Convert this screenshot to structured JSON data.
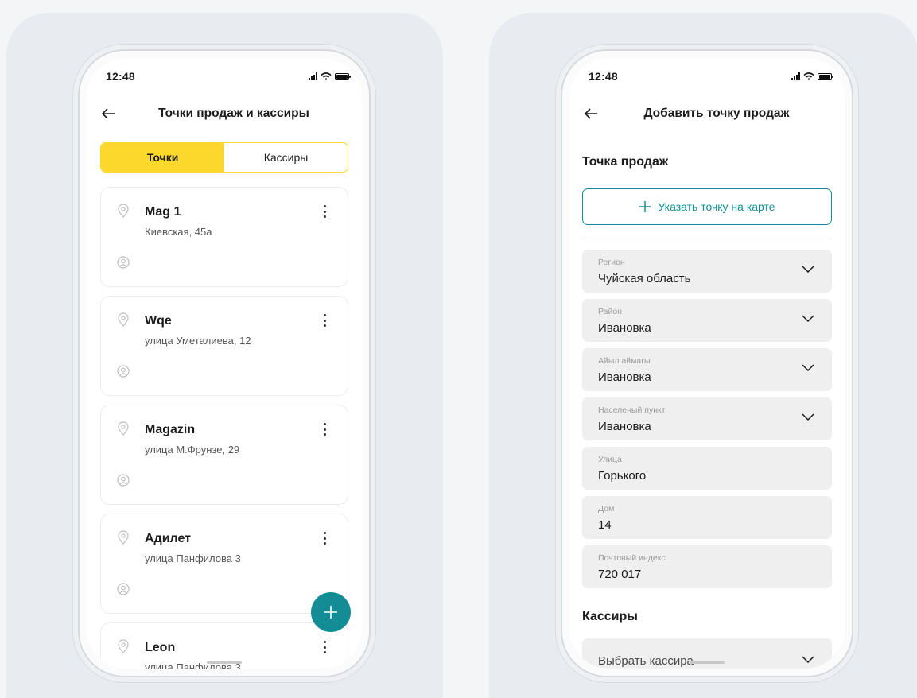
{
  "left_screen": {
    "status_time": "12:48",
    "title": "Точки продаж и кассиры",
    "tabs": [
      "Точки",
      "Кассиры"
    ],
    "cards": [
      {
        "name": "Mag 1",
        "address": "Киевская, 45а"
      },
      {
        "name": "Wqe",
        "address": "улица Уметалиева, 12"
      },
      {
        "name": "Magazin",
        "address": "улица М.Фрунзе, 29"
      },
      {
        "name": "Адилет",
        "address": "улица Панфилова 3"
      },
      {
        "name": "Leon",
        "address": "улица Панфилова 3"
      }
    ],
    "fab_icon": "plus-icon"
  },
  "right_screen": {
    "status_time": "12:48",
    "title": "Добавить точку продаж",
    "section_point": "Точка продаж",
    "map_button_label": "Указать точку на карте",
    "fields": [
      {
        "label": "Регион",
        "value": "Чуйская область",
        "dropdown": true
      },
      {
        "label": "Район",
        "value": "Ивановка",
        "dropdown": true
      },
      {
        "label": "Айыл аймагы",
        "value": "Ивановка",
        "dropdown": true
      },
      {
        "label": "Населеный пункт",
        "value": "Ивановка",
        "dropdown": true
      },
      {
        "label": "Улица",
        "value": "Горького",
        "dropdown": false
      },
      {
        "label": "Дом",
        "value": "14",
        "dropdown": false
      },
      {
        "label": "Почтовый индекс",
        "value": "720 017",
        "dropdown": false
      }
    ],
    "section_cashiers": "Кассиры",
    "cashier_placeholder": "Выбрать кассира"
  },
  "colors": {
    "accent_yellow": "#fdd82c",
    "accent_teal": "#138c95"
  }
}
